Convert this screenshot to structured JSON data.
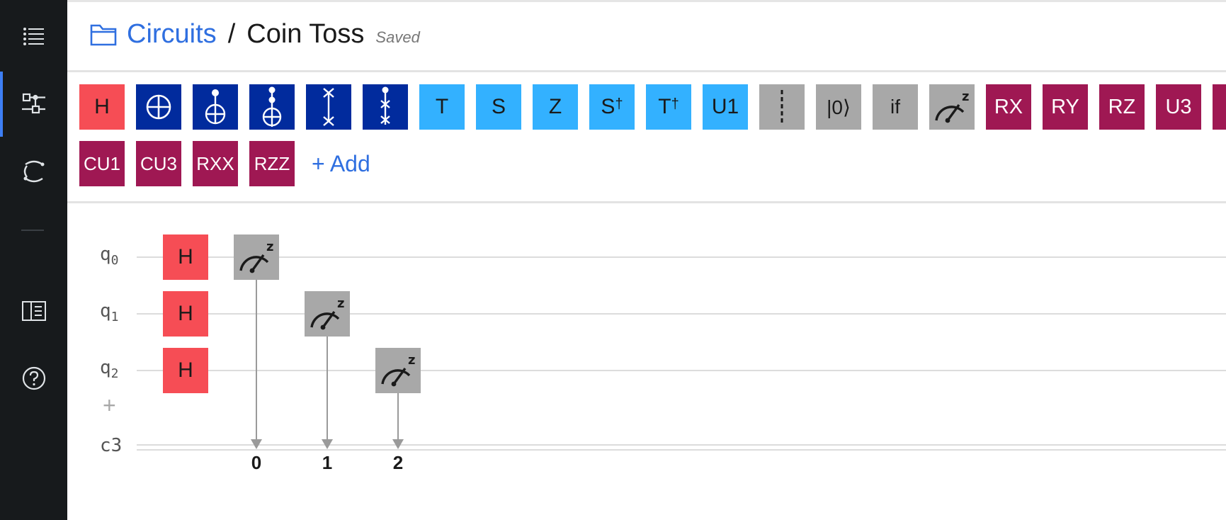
{
  "breadcrumb": {
    "parent": "Circuits",
    "separator": "/",
    "title": "Coin Toss",
    "status": "Saved"
  },
  "sidebar": {
    "items": [
      {
        "name": "menu",
        "icon": "menu-icon"
      },
      {
        "name": "circuit-composer",
        "icon": "circuit-icon",
        "active": true
      },
      {
        "name": "quantum-lab",
        "icon": "orbit-icon"
      },
      {
        "name": "docs",
        "icon": "book-icon"
      },
      {
        "name": "help",
        "icon": "help-icon"
      }
    ]
  },
  "palette": {
    "row1": [
      "H",
      "CNOT",
      "Toffoli",
      "CCX",
      "SWAP",
      "CSWAP",
      "T",
      "S",
      "Z",
      "S†",
      "T†",
      "U1",
      "barrier",
      "|0⟩",
      "if",
      "measure",
      "RX",
      "RY",
      "RZ",
      "U3"
    ],
    "row2": [
      "CU1",
      "CU3",
      "RXX",
      "RZZ"
    ],
    "add_label": "+ Add",
    "colors": {
      "h": "#f64d55",
      "navy": "#012b9d",
      "sky": "#33b1ff",
      "gray": "#a8a8a8",
      "wine": "#9f1853"
    }
  },
  "gates": {
    "h": "H",
    "t": "T",
    "s": "S",
    "z": "Z",
    "sdg": "S",
    "tdg": "T",
    "dagger": "†",
    "u1": "U1",
    "reset": "|0⟩",
    "if": "if",
    "rx": "RX",
    "ry": "RY",
    "rz": "RZ",
    "u3": "U3",
    "cu1": "CU1",
    "cu3": "CU3",
    "rxx": "RXX",
    "rzz": "RZZ"
  },
  "circuit": {
    "qubits": [
      {
        "letter": "q",
        "index": "0"
      },
      {
        "letter": "q",
        "index": "1"
      },
      {
        "letter": "q",
        "index": "2"
      }
    ],
    "classical": "c3",
    "add_qubit": "+",
    "bits": [
      "0",
      "1",
      "2"
    ],
    "placed_gate": "H"
  }
}
